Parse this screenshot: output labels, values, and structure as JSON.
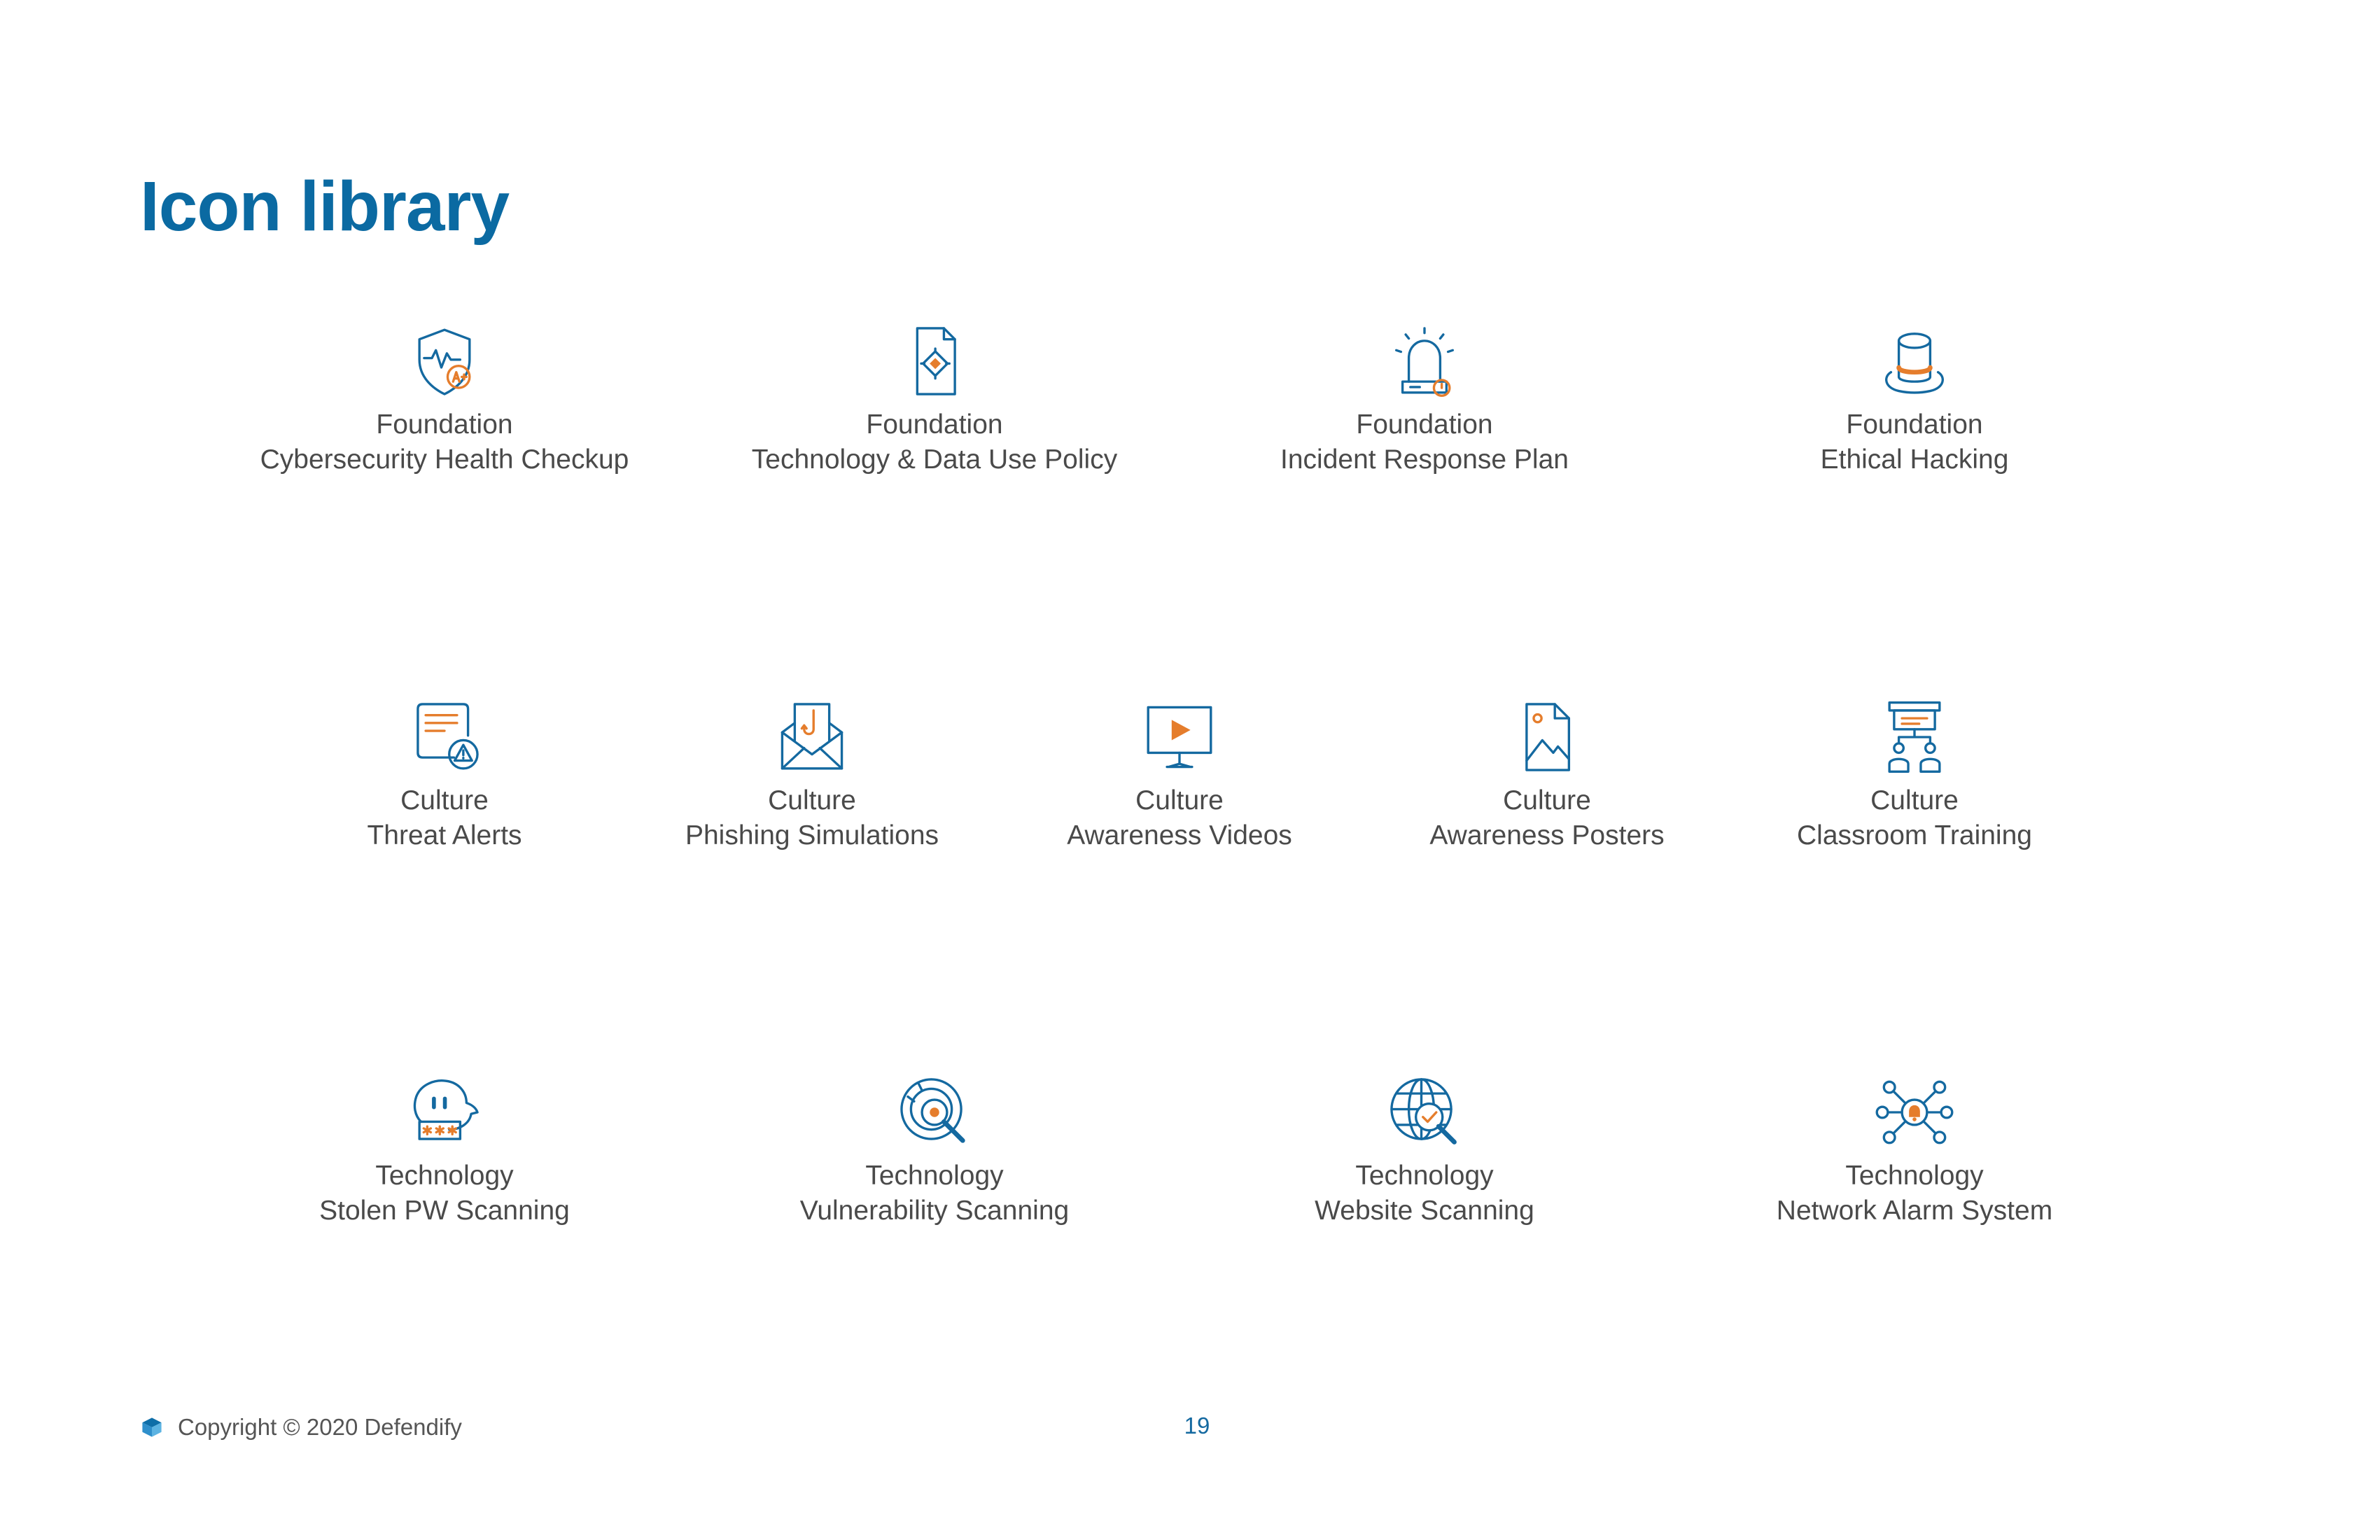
{
  "page": {
    "title": "Icon library",
    "accent_color": "#0b6aa2",
    "icon_stroke_color": "#1469a0",
    "icon_highlight_color": "#e57d2c",
    "text_color": "#4a4a4a"
  },
  "rows": [
    {
      "tiles": [
        {
          "category": "Foundation",
          "name": "Cybersecurity Health Checkup",
          "icon": "shield-heartbeat-grade-icon"
        },
        {
          "category": "Foundation",
          "name": "Technology & Data Use Policy",
          "icon": "document-chip-icon"
        },
        {
          "category": "Foundation",
          "name": "Incident Response Plan",
          "icon": "alarm-siren-icon"
        },
        {
          "category": "Foundation",
          "name": "Ethical Hacking",
          "icon": "white-hat-icon"
        }
      ]
    },
    {
      "tiles": [
        {
          "category": "Culture",
          "name": "Threat Alerts",
          "icon": "warning-message-icon"
        },
        {
          "category": "Culture",
          "name": "Phishing Simulations",
          "icon": "envelope-hook-icon"
        },
        {
          "category": "Culture",
          "name": "Awareness Videos",
          "icon": "video-monitor-icon"
        },
        {
          "category": "Culture",
          "name": "Awareness Posters",
          "icon": "poster-image-icon"
        },
        {
          "category": "Culture",
          "name": "Classroom Training",
          "icon": "classroom-icon"
        }
      ]
    },
    {
      "tiles": [
        {
          "category": "Technology",
          "name": "Stolen PW Scanning",
          "icon": "password-chat-icon"
        },
        {
          "category": "Technology",
          "name": "Vulnerability Scanning",
          "icon": "target-magnifier-icon"
        },
        {
          "category": "Technology",
          "name": "Website Scanning",
          "icon": "globe-check-icon"
        },
        {
          "category": "Technology",
          "name": "Network Alarm System",
          "icon": "network-bell-icon"
        }
      ]
    }
  ],
  "footer": {
    "copyright": "Copyright © 2020 Defendify",
    "logo_icon": "defendify-cube-icon",
    "page_number": "19"
  }
}
